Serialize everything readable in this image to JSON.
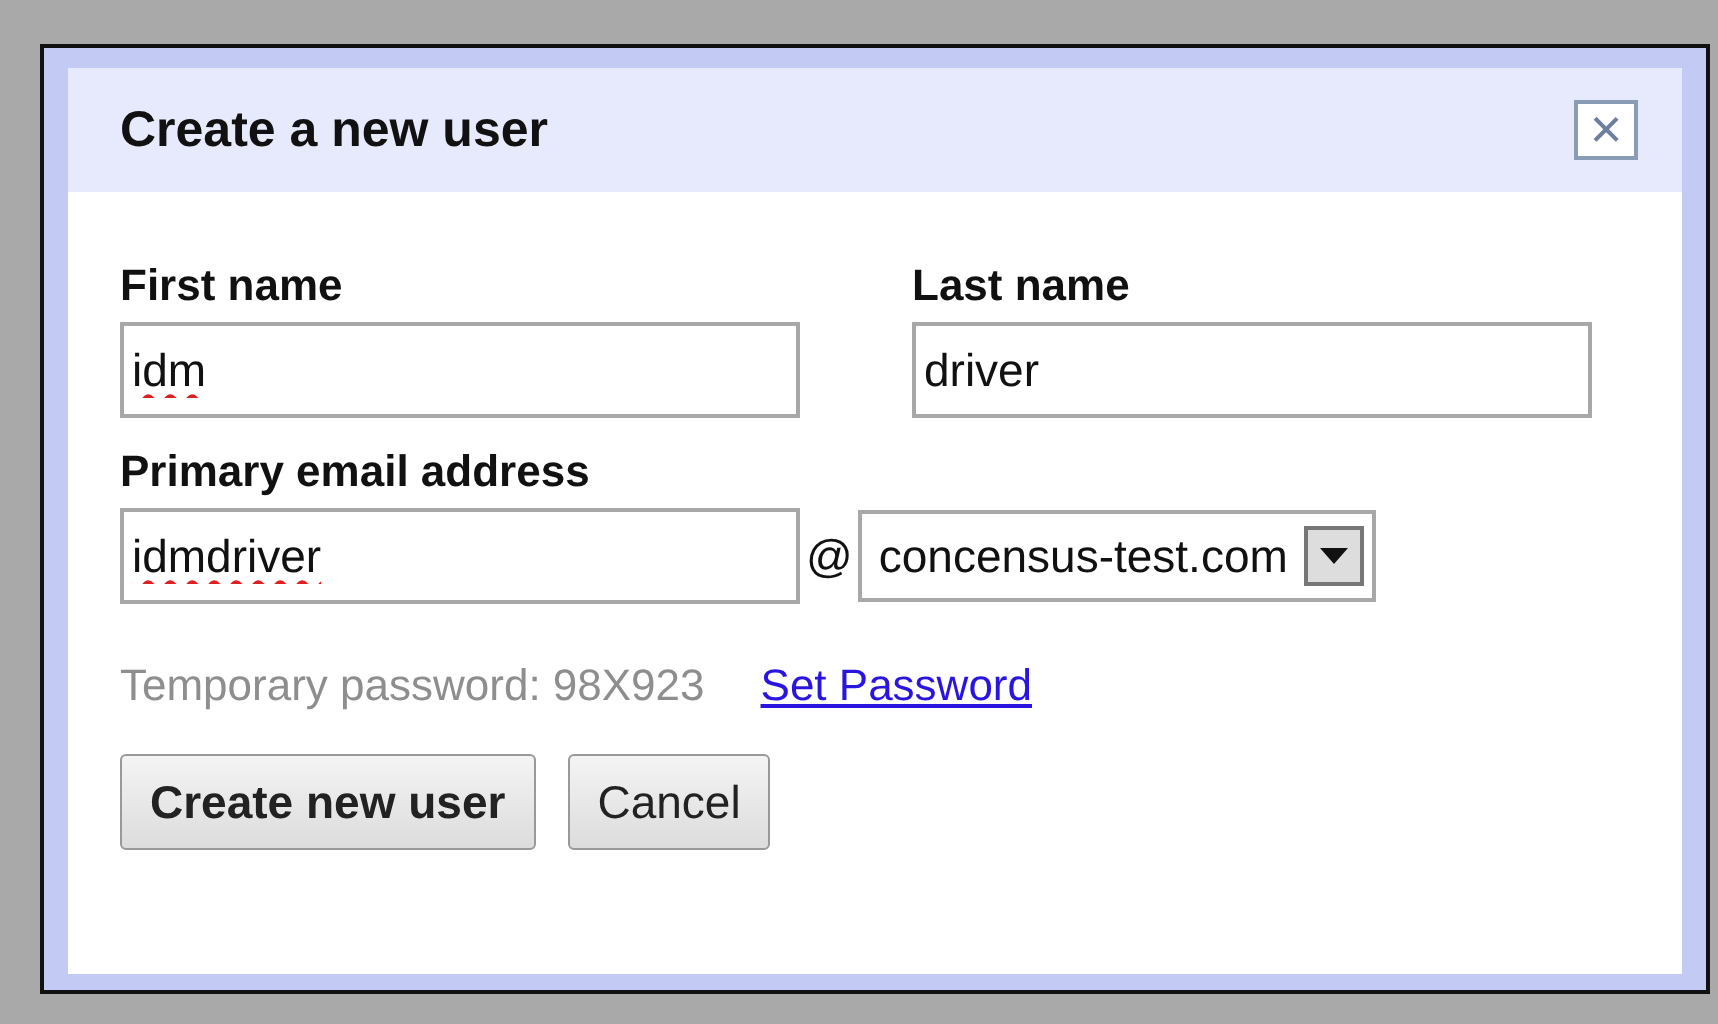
{
  "dialog": {
    "title": "Create a new user",
    "close_label": "×"
  },
  "first_name": {
    "label": "First name",
    "value": "idm",
    "spellcheck_error": true
  },
  "last_name": {
    "label": "Last name",
    "value": "driver",
    "spellcheck_error": false
  },
  "email": {
    "label": "Primary email address",
    "value": "idmdriver",
    "spellcheck_error": true,
    "at": "@",
    "domain": "concensus-test.com"
  },
  "temporary_password": {
    "text": "Temporary password: 98X923",
    "link": "Set Password"
  },
  "buttons": [
    {
      "label": "Create new user",
      "kind": "primary"
    },
    {
      "label": "Cancel",
      "kind": "secondary"
    }
  ]
}
